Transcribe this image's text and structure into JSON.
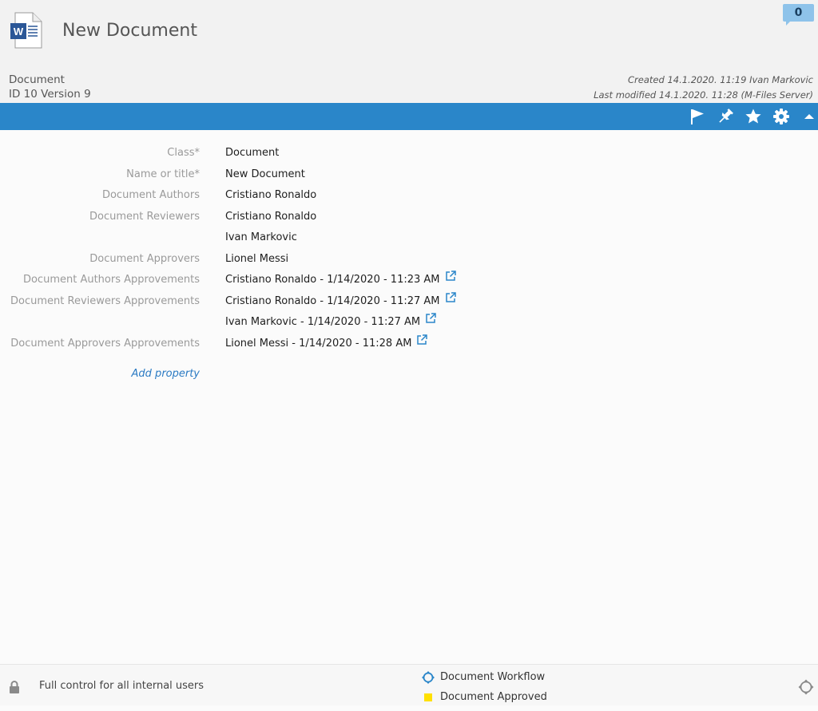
{
  "header": {
    "title": "New Document",
    "comment_count": "0",
    "object_type": "Document",
    "id_version": "ID 10  Version 9",
    "created": "Created 14.1.2020. 11:19 Ivan Markovic",
    "last_modified": "Last modified 14.1.2020. 11:28 (M-Files Server)",
    "file_icon_letter": "W",
    "file_icon_color": "#2b5797"
  },
  "toolbar": {
    "icons": [
      "flag-icon",
      "pin-icon",
      "star-icon",
      "gear-icon",
      "collapse-up-icon"
    ],
    "background": "#2a86c9"
  },
  "properties": [
    {
      "label": "Class*",
      "value": "Document"
    },
    {
      "label": "Name or title*",
      "value": "New Document"
    },
    {
      "label": "Document Authors",
      "value": "Cristiano Ronaldo"
    },
    {
      "label": "Document Reviewers",
      "value": "Cristiano Ronaldo"
    },
    {
      "label": "",
      "value": "Ivan Markovic"
    },
    {
      "label": "Document Approvers",
      "value": "Lionel Messi"
    },
    {
      "label": "Document Authors Approvements",
      "value": "Cristiano Ronaldo - 1/14/2020 - 11:23 AM",
      "link": true
    },
    {
      "label": "Document Reviewers Approvements",
      "value": "Cristiano Ronaldo - 1/14/2020 - 11:27 AM",
      "link": true
    },
    {
      "label": "",
      "value": "Ivan Markovic - 1/14/2020 - 11:27 AM",
      "link": true
    },
    {
      "label": "Document Approvers Approvements",
      "value": "Lionel Messi - 1/14/2020 - 11:28 AM",
      "link": true
    }
  ],
  "add_property": "Add property",
  "footer": {
    "permissions": "Full control for all internal users",
    "workflow": "Document Workflow",
    "state": "Document Approved",
    "state_color": "#ffe000"
  }
}
